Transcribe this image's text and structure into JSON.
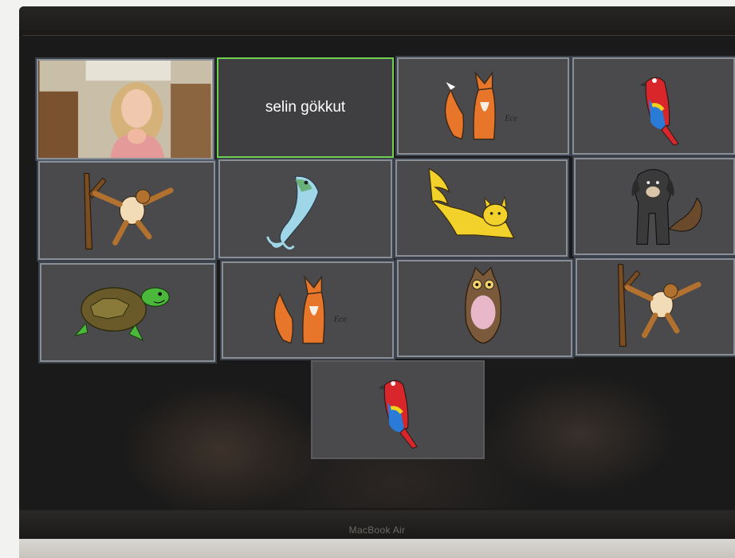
{
  "gallery": {
    "participants": [
      {
        "id": "camera",
        "icon": "participant-video"
      },
      {
        "id": "name-tile",
        "display_name": "selin gökkut"
      },
      {
        "id": "fox-1",
        "icon": "fox-drawing"
      },
      {
        "id": "parrot-1",
        "icon": "parrot-drawing"
      },
      {
        "id": "monkey-1",
        "icon": "monkey-drawing"
      },
      {
        "id": "fish-1",
        "icon": "fish-drawing"
      },
      {
        "id": "cat-1",
        "icon": "cat-drawing"
      },
      {
        "id": "dog-1",
        "icon": "dog-drawing"
      },
      {
        "id": "turtle-1",
        "icon": "turtle-drawing"
      },
      {
        "id": "fox-2",
        "icon": "fox-drawing"
      },
      {
        "id": "owl-1",
        "icon": "owl-drawing"
      },
      {
        "id": "monkey-2",
        "icon": "monkey-drawing"
      },
      {
        "id": "parrot-2",
        "icon": "parrot-drawing"
      }
    ],
    "active_speaker_color": "#6fcf50"
  },
  "device": {
    "brand_label": "MacBook Air"
  }
}
